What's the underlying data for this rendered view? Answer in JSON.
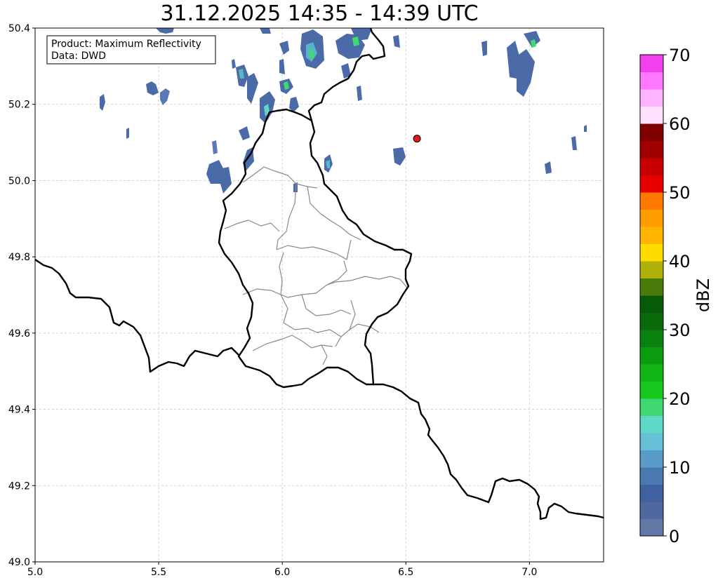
{
  "title": "31.12.2025 14:35 - 14:39 UTC",
  "info_box": {
    "line1": "Product: Maximum Reflectivity",
    "line2": "Data: DWD"
  },
  "map": {
    "lon_range": [
      5.0,
      7.3
    ],
    "lat_range": [
      49.0,
      50.4
    ],
    "x_ticks": [
      5.0,
      5.5,
      6.0,
      6.5,
      7.0
    ],
    "x_tick_labels": [
      "5.0",
      "5.5",
      "6.0",
      "6.5",
      "7.0"
    ],
    "y_ticks": [
      49.0,
      49.2,
      49.4,
      49.6,
      49.8,
      50.0,
      50.2,
      50.4
    ],
    "y_tick_labels": [
      "49.0",
      "49.2",
      "49.4",
      "49.6",
      "49.8",
      "50.0",
      "50.2",
      "50.4"
    ],
    "grid": true,
    "marker": {
      "lon": 6.545,
      "lat": 50.11,
      "color": "#e31a1c"
    }
  },
  "colorbar": {
    "label": "dBZ",
    "min": 0,
    "max": 70,
    "tick_values": [
      0,
      10,
      20,
      30,
      40,
      50,
      60,
      70
    ],
    "tick_labels": [
      "0",
      "10",
      "20",
      "30",
      "40",
      "50",
      "60",
      "70"
    ],
    "colors": [
      "#6478a8",
      "#5068a0",
      "#4060a0",
      "#4a78b0",
      "#5a9cc8",
      "#66c0d8",
      "#60d8c8",
      "#40d870",
      "#14c81e",
      "#10b414",
      "#0c9c10",
      "#0a8010",
      "#0a6a0a",
      "#085a08",
      "#4a7a0a",
      "#b0b00a",
      "#ffdc00",
      "#ffb400",
      "#ff9c00",
      "#ff7800",
      "#e60000",
      "#c80000",
      "#a00000",
      "#800000",
      "#ffe0ff",
      "#ffb4ff",
      "#ff78ff",
      "#f040f0"
    ]
  }
}
